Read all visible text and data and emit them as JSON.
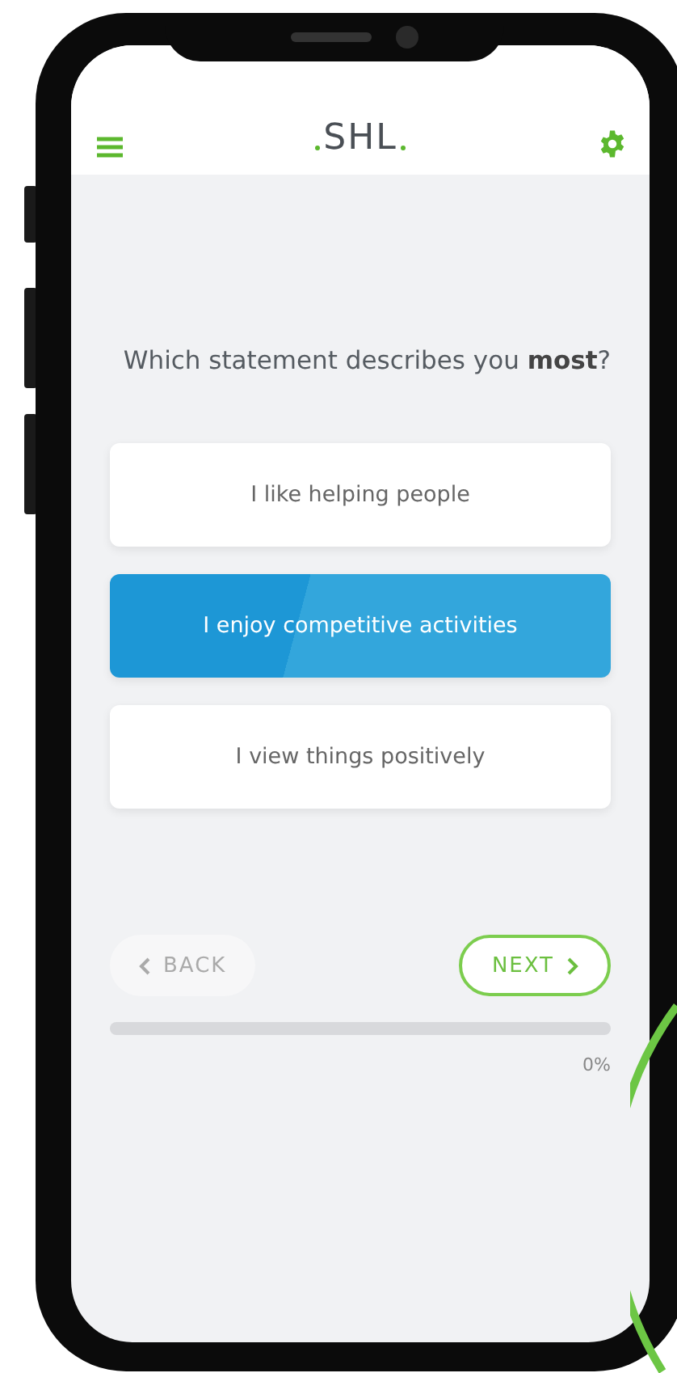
{
  "header": {
    "logo": "SHL"
  },
  "question": {
    "text": "Which statement describes you **most**?"
  },
  "options": [
    {
      "label": "I like helping people",
      "selected": false
    },
    {
      "label": "I enjoy competitive activities",
      "selected": true
    },
    {
      "label": "I view things positively",
      "selected": false
    }
  ],
  "navigation": {
    "back": {
      "label": "BACK",
      "disabled": true
    },
    "next": {
      "label": "NEXT",
      "disabled": false
    }
  },
  "progress": {
    "level": 0,
    "reading": "0%"
  }
}
